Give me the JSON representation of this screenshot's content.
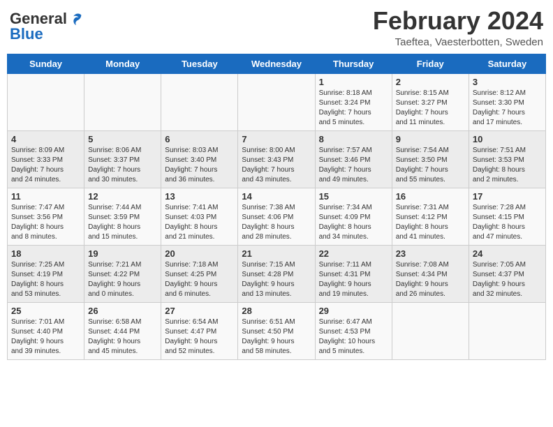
{
  "logo": {
    "general": "General",
    "blue": "Blue"
  },
  "header": {
    "title": "February 2024",
    "subtitle": "Taeftea, Vaesterbotten, Sweden"
  },
  "days_of_week": [
    "Sunday",
    "Monday",
    "Tuesday",
    "Wednesday",
    "Thursday",
    "Friday",
    "Saturday"
  ],
  "weeks": [
    [
      {
        "day": "",
        "info": ""
      },
      {
        "day": "",
        "info": ""
      },
      {
        "day": "",
        "info": ""
      },
      {
        "day": "",
        "info": ""
      },
      {
        "day": "1",
        "info": "Sunrise: 8:18 AM\nSunset: 3:24 PM\nDaylight: 7 hours\nand 5 minutes."
      },
      {
        "day": "2",
        "info": "Sunrise: 8:15 AM\nSunset: 3:27 PM\nDaylight: 7 hours\nand 11 minutes."
      },
      {
        "day": "3",
        "info": "Sunrise: 8:12 AM\nSunset: 3:30 PM\nDaylight: 7 hours\nand 17 minutes."
      }
    ],
    [
      {
        "day": "4",
        "info": "Sunrise: 8:09 AM\nSunset: 3:33 PM\nDaylight: 7 hours\nand 24 minutes."
      },
      {
        "day": "5",
        "info": "Sunrise: 8:06 AM\nSunset: 3:37 PM\nDaylight: 7 hours\nand 30 minutes."
      },
      {
        "day": "6",
        "info": "Sunrise: 8:03 AM\nSunset: 3:40 PM\nDaylight: 7 hours\nand 36 minutes."
      },
      {
        "day": "7",
        "info": "Sunrise: 8:00 AM\nSunset: 3:43 PM\nDaylight: 7 hours\nand 43 minutes."
      },
      {
        "day": "8",
        "info": "Sunrise: 7:57 AM\nSunset: 3:46 PM\nDaylight: 7 hours\nand 49 minutes."
      },
      {
        "day": "9",
        "info": "Sunrise: 7:54 AM\nSunset: 3:50 PM\nDaylight: 7 hours\nand 55 minutes."
      },
      {
        "day": "10",
        "info": "Sunrise: 7:51 AM\nSunset: 3:53 PM\nDaylight: 8 hours\nand 2 minutes."
      }
    ],
    [
      {
        "day": "11",
        "info": "Sunrise: 7:47 AM\nSunset: 3:56 PM\nDaylight: 8 hours\nand 8 minutes."
      },
      {
        "day": "12",
        "info": "Sunrise: 7:44 AM\nSunset: 3:59 PM\nDaylight: 8 hours\nand 15 minutes."
      },
      {
        "day": "13",
        "info": "Sunrise: 7:41 AM\nSunset: 4:03 PM\nDaylight: 8 hours\nand 21 minutes."
      },
      {
        "day": "14",
        "info": "Sunrise: 7:38 AM\nSunset: 4:06 PM\nDaylight: 8 hours\nand 28 minutes."
      },
      {
        "day": "15",
        "info": "Sunrise: 7:34 AM\nSunset: 4:09 PM\nDaylight: 8 hours\nand 34 minutes."
      },
      {
        "day": "16",
        "info": "Sunrise: 7:31 AM\nSunset: 4:12 PM\nDaylight: 8 hours\nand 41 minutes."
      },
      {
        "day": "17",
        "info": "Sunrise: 7:28 AM\nSunset: 4:15 PM\nDaylight: 8 hours\nand 47 minutes."
      }
    ],
    [
      {
        "day": "18",
        "info": "Sunrise: 7:25 AM\nSunset: 4:19 PM\nDaylight: 8 hours\nand 53 minutes."
      },
      {
        "day": "19",
        "info": "Sunrise: 7:21 AM\nSunset: 4:22 PM\nDaylight: 9 hours\nand 0 minutes."
      },
      {
        "day": "20",
        "info": "Sunrise: 7:18 AM\nSunset: 4:25 PM\nDaylight: 9 hours\nand 6 minutes."
      },
      {
        "day": "21",
        "info": "Sunrise: 7:15 AM\nSunset: 4:28 PM\nDaylight: 9 hours\nand 13 minutes."
      },
      {
        "day": "22",
        "info": "Sunrise: 7:11 AM\nSunset: 4:31 PM\nDaylight: 9 hours\nand 19 minutes."
      },
      {
        "day": "23",
        "info": "Sunrise: 7:08 AM\nSunset: 4:34 PM\nDaylight: 9 hours\nand 26 minutes."
      },
      {
        "day": "24",
        "info": "Sunrise: 7:05 AM\nSunset: 4:37 PM\nDaylight: 9 hours\nand 32 minutes."
      }
    ],
    [
      {
        "day": "25",
        "info": "Sunrise: 7:01 AM\nSunset: 4:40 PM\nDaylight: 9 hours\nand 39 minutes."
      },
      {
        "day": "26",
        "info": "Sunrise: 6:58 AM\nSunset: 4:44 PM\nDaylight: 9 hours\nand 45 minutes."
      },
      {
        "day": "27",
        "info": "Sunrise: 6:54 AM\nSunset: 4:47 PM\nDaylight: 9 hours\nand 52 minutes."
      },
      {
        "day": "28",
        "info": "Sunrise: 6:51 AM\nSunset: 4:50 PM\nDaylight: 9 hours\nand 58 minutes."
      },
      {
        "day": "29",
        "info": "Sunrise: 6:47 AM\nSunset: 4:53 PM\nDaylight: 10 hours\nand 5 minutes."
      },
      {
        "day": "",
        "info": ""
      },
      {
        "day": "",
        "info": ""
      }
    ]
  ]
}
